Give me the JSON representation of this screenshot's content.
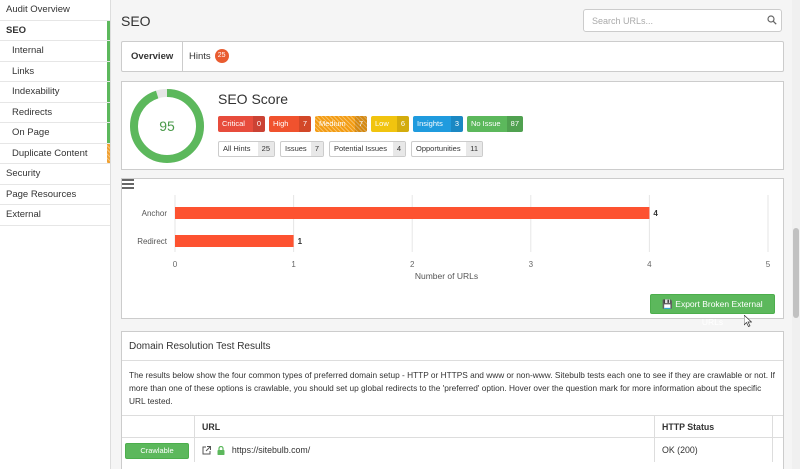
{
  "sidebar": {
    "items": [
      {
        "label": "Audit Overview"
      },
      {
        "label": "SEO"
      },
      {
        "label": "Internal"
      },
      {
        "label": "Links"
      },
      {
        "label": "Indexability"
      },
      {
        "label": "Redirects"
      },
      {
        "label": "On Page"
      },
      {
        "label": "Duplicate Content"
      },
      {
        "label": "Security"
      },
      {
        "label": "Page Resources"
      },
      {
        "label": "External"
      }
    ],
    "colors": {
      "green": "#5cb85c",
      "orange": "#f0a030"
    }
  },
  "header": {
    "title": "SEO",
    "search_placeholder": "Search URLs..."
  },
  "tabs": [
    {
      "label": "Overview"
    },
    {
      "label": "Hints",
      "count": "25"
    }
  ],
  "score": {
    "title": "SEO Score",
    "value": "95",
    "fraction": 0.95,
    "ring_color": "#5cb85c",
    "badges": [
      {
        "label": "Critical",
        "count": "0",
        "color": "#e74c3c"
      },
      {
        "label": "High",
        "count": "7",
        "color": "#f0522e"
      },
      {
        "label": "Medium",
        "count": "7",
        "color": "#f39c12"
      },
      {
        "label": "Low",
        "count": "6",
        "color": "#f1c40f"
      },
      {
        "label": "Insights",
        "count": "3",
        "color": "#1f9bde"
      },
      {
        "label": "No Issue",
        "count": "87",
        "color": "#5cb85c"
      }
    ],
    "filters": [
      {
        "label": "All Hints",
        "count": "25"
      },
      {
        "label": "Issues",
        "count": "7"
      },
      {
        "label": "Potential Issues",
        "count": "4"
      },
      {
        "label": "Opportunities",
        "count": "11"
      }
    ]
  },
  "chart_data": {
    "type": "bar",
    "orientation": "horizontal",
    "categories": [
      "Anchor",
      "Redirect"
    ],
    "values": [
      4,
      1
    ],
    "xlabel": "Number of URLs",
    "ylabel": "",
    "xlim": [
      0,
      5
    ],
    "ticks": [
      "0",
      "1",
      "2",
      "3",
      "4",
      "5"
    ],
    "bar_color": "#fd5230",
    "grid": true
  },
  "export_button": {
    "label": "Export Broken External URLs"
  },
  "domain": {
    "title": "Domain Resolution Test Results",
    "description": "The results below show the four common types of preferred domain setup - HTTP or HTTPS and www or non-www. Sitebulb tests each one to see if they are crawlable or not. If more than one of these options is crawlable, you should set up global redirects to the 'preferred' option. Hover over the question mark for more information about the specific URL tested.",
    "columns": [
      "",
      "URL",
      "HTTP Status"
    ],
    "rows": [
      {
        "status_button": "Crawlable",
        "url": "https://sitebulb.com/",
        "http_status": "OK (200)"
      }
    ]
  }
}
